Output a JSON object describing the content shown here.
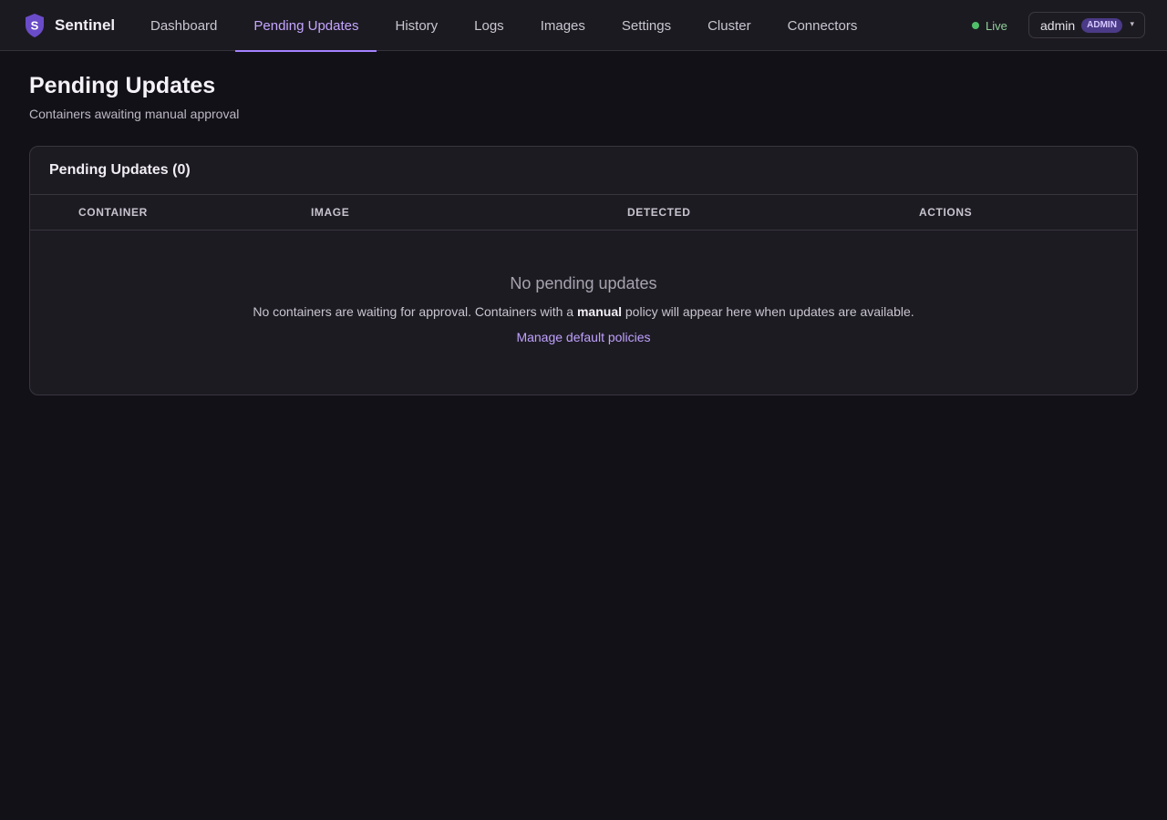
{
  "brand": {
    "name": "Sentinel",
    "logo_letter": "S",
    "logo_icon": "shield-icon"
  },
  "nav": {
    "tabs": [
      {
        "label": "Dashboard",
        "active": false
      },
      {
        "label": "Pending Updates",
        "active": true
      },
      {
        "label": "History",
        "active": false
      },
      {
        "label": "Logs",
        "active": false
      },
      {
        "label": "Images",
        "active": false
      },
      {
        "label": "Settings",
        "active": false
      },
      {
        "label": "Cluster",
        "active": false
      },
      {
        "label": "Connectors",
        "active": false
      }
    ]
  },
  "status": {
    "label": "Live",
    "color": "#4fbf6a"
  },
  "user": {
    "name": "admin",
    "role": "ADMIN",
    "caret": "▾"
  },
  "page": {
    "title": "Pending Updates",
    "subtitle": "Containers awaiting manual approval"
  },
  "card": {
    "title": "Pending Updates (0)",
    "columns": [
      "CONTAINER",
      "IMAGE",
      "DETECTED",
      "ACTIONS"
    ],
    "rows": [],
    "empty": {
      "title": "No pending updates",
      "text_before": "No containers are waiting for approval. Containers with a ",
      "text_bold": "manual",
      "text_after": " policy will appear here when updates are available.",
      "link": "Manage default policies"
    }
  },
  "colors": {
    "accent": "#a583ff",
    "background": "#131118",
    "surface": "#1d1b22"
  }
}
